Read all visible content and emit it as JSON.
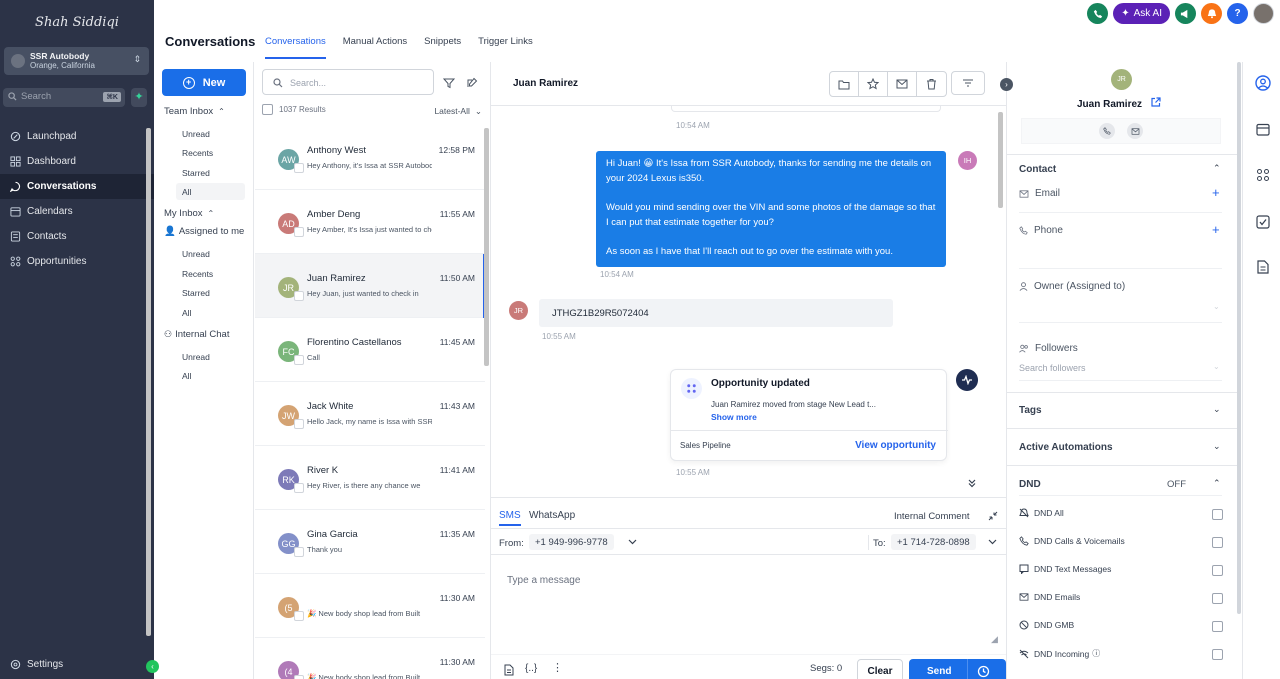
{
  "sidebar": {
    "logo_text": "Shah Siddiqi",
    "account_name": "SSR Autobody",
    "account_location": "Orange, California",
    "search_placeholder": "Search",
    "search_shortcut": "⌘K",
    "nav": [
      {
        "label": "Launchpad",
        "icon": "rocket-icon"
      },
      {
        "label": "Dashboard",
        "icon": "grid-icon"
      },
      {
        "label": "Conversations",
        "icon": "chat-icon",
        "active": true
      },
      {
        "label": "Calendars",
        "icon": "calendar-icon"
      },
      {
        "label": "Contacts",
        "icon": "contacts-icon"
      },
      {
        "label": "Opportunities",
        "icon": "opportunities-icon"
      }
    ],
    "settings_label": "Settings"
  },
  "header": {
    "title": "Conversations",
    "tabs": [
      "Conversations",
      "Manual Actions",
      "Snippets",
      "Trigger Links"
    ],
    "ask_ai_label": "Ask AI",
    "help_label": "?"
  },
  "inbox": {
    "new_label": "New",
    "team_inbox": "Team Inbox",
    "team_items": [
      "Unread",
      "Recents",
      "Starred",
      "All"
    ],
    "my_inbox": "My Inbox",
    "assigned_to_me": "Assigned to me",
    "assigned_items": [
      "Unread",
      "Recents",
      "Starred",
      "All"
    ],
    "internal_chat": "Internal Chat",
    "internal_items": [
      "Unread",
      "All"
    ]
  },
  "list": {
    "search_placeholder": "Search...",
    "results": "1037 Results",
    "sort_label": "Latest-All",
    "rows": [
      {
        "initials": "AW",
        "name": "Anthony West",
        "time": "12:58 PM",
        "preview": "Hey Anthony, it's Issa at SSR Autobody",
        "color": "#6ba5a5"
      },
      {
        "initials": "AD",
        "name": "Amber Deng",
        "time": "11:55 AM",
        "preview": "Hey Amber, It's Issa just wanted to check",
        "color": "#c97a78"
      },
      {
        "initials": "JR",
        "name": "Juan Ramirez",
        "time": "11:50 AM",
        "preview": "Hey Juan, just wanted to check in",
        "color": "#a3b37a",
        "selected": true
      },
      {
        "initials": "FC",
        "name": "Florentino Castellanos",
        "time": "11:45 AM",
        "preview": "Call",
        "color": "#7ab57a"
      },
      {
        "initials": "JW",
        "name": "Jack White",
        "time": "11:43 AM",
        "preview": "Hello Jack, my name is Issa with SSR",
        "color": "#d4a373"
      },
      {
        "initials": "RK",
        "name": "River K",
        "time": "11:41 AM",
        "preview": "Hey River, is there any chance we",
        "color": "#7d7ab8"
      },
      {
        "initials": "GG",
        "name": "Gina Garcia",
        "time": "11:35 AM",
        "preview": "Thank you",
        "color": "#8390c9"
      },
      {
        "initials": "(5",
        "name": "",
        "time": "11:30 AM",
        "preview": "🎉 New body shop lead from Built",
        "color": "#d4a373"
      },
      {
        "initials": "(4",
        "name": "",
        "time": "11:30 AM",
        "preview": "🎉 New body shop lead from Built",
        "color": "#b07ab8"
      }
    ]
  },
  "conversation": {
    "contact_name": "Juan Ramirez",
    "messages": {
      "ts_top": "10:54 AM",
      "out_initials": "IH",
      "out_paragraphs": [
        "Hi Juan! 😀 It's Issa from SSR Autobody, thanks for sending me the details on your 2024 Lexus is350.",
        "Would you mind sending over the VIN and some photos of the damage so that I can put that estimate together for you?",
        "As soon as I have that I'll reach out to go over the estimate with you."
      ],
      "out_time": "10:54 AM",
      "in_initials": "JR",
      "in_text": "JTHGZ1B29R5072404",
      "in_time": "10:55 AM",
      "opp_title": "Opportunity updated",
      "opp_desc": "Juan Ramirez moved from stage New Lead t...",
      "opp_show_more": "Show more",
      "opp_pipeline": "Sales Pipeline",
      "opp_view": "View opportunity",
      "opp_time": "10:55 AM"
    },
    "composer": {
      "tab_sms": "SMS",
      "tab_whatsapp": "WhatsApp",
      "internal_comment": "Internal Comment",
      "from_label": "From:",
      "from_number": "+1 949-996-9778",
      "to_label": "To:",
      "to_number": "+1 714-728-0898",
      "placeholder": "Type a message",
      "segs": "Segs: 0",
      "clear": "Clear",
      "send": "Send"
    }
  },
  "contact_panel": {
    "initials": "JR",
    "name": "Juan Ramirez",
    "contact_section": "Contact",
    "email_label": "Email",
    "phone_label": "Phone",
    "owner_label": "Owner (Assigned to)",
    "followers_label": "Followers",
    "followers_placeholder": "Search followers",
    "tags_label": "Tags",
    "automations_label": "Active Automations",
    "dnd_label": "DND",
    "dnd_status": "OFF",
    "dnd_items": [
      "DND All",
      "DND Calls & Voicemails",
      "DND Text Messages",
      "DND Emails",
      "DND GMB",
      "DND Incoming"
    ]
  },
  "colors": {
    "sidebar_bg": "#2c3347",
    "accent_blue": "#1a6ee8",
    "bubble_out": "#1a7de6"
  }
}
